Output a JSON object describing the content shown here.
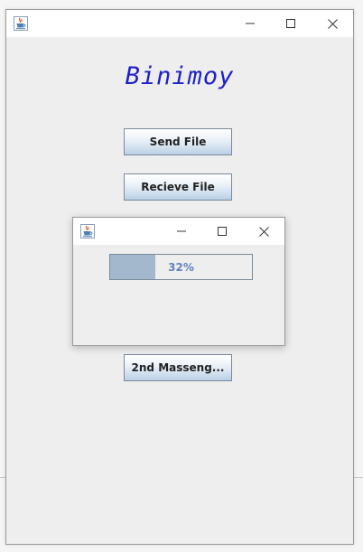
{
  "main_window": {
    "title": "",
    "app_title": "Binimoy",
    "buttons": {
      "send_file": "Send File",
      "receive_file": "Recieve File",
      "second_messenger": "2nd Masseng..."
    }
  },
  "progress_dialog": {
    "title": "",
    "progress": {
      "value": 0.32,
      "text": "32%"
    }
  },
  "icons": {
    "app_icon": "java-coffee-cup-icon",
    "minimize": "minimize-icon",
    "maximize": "maximize-icon",
    "close": "close-icon"
  },
  "colors": {
    "app_title": "#2020c8",
    "progress_fill": "#a3b8cc",
    "progress_text": "#6382bf",
    "window_bg": "#eeeeee",
    "titlebar_bg": "#ffffff"
  }
}
